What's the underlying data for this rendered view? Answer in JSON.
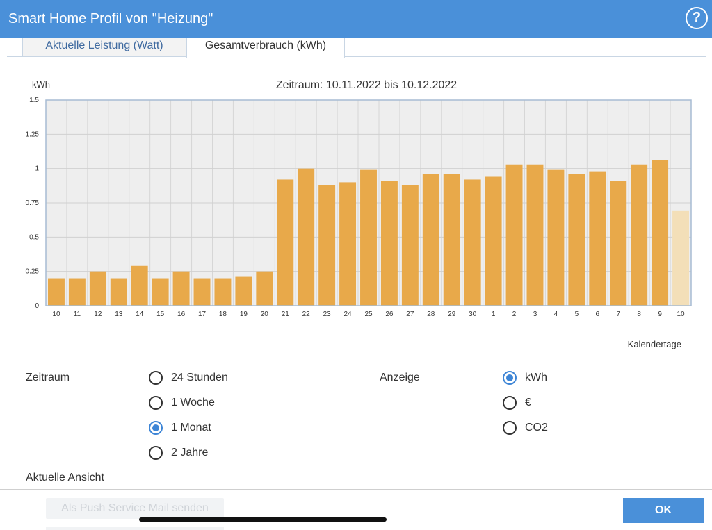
{
  "app": {
    "title": "Smart Home Profil von \"Heizung\"",
    "help_label": "?"
  },
  "tabs": [
    {
      "label": "Aktuelle Leistung (Watt)",
      "active": false
    },
    {
      "label": "Gesamtverbrauch (kWh)",
      "active": true
    }
  ],
  "chart_data": {
    "type": "bar",
    "title": "Zeitraum: 10.11.2022 bis 10.12.2022",
    "ylabel": "kWh",
    "xlabel": "Kalendertage",
    "ylim": [
      0,
      1.5
    ],
    "yticks": [
      "0",
      "0.25",
      "0.5",
      "0.75",
      "1",
      "1.25",
      "1.5"
    ],
    "grid": true,
    "categories": [
      "10",
      "11",
      "12",
      "13",
      "14",
      "15",
      "16",
      "17",
      "18",
      "19",
      "20",
      "21",
      "22",
      "23",
      "24",
      "25",
      "26",
      "27",
      "28",
      "29",
      "30",
      "1",
      "2",
      "3",
      "4",
      "5",
      "6",
      "7",
      "8",
      "9",
      "10"
    ],
    "values": [
      0.2,
      0.2,
      0.25,
      0.2,
      0.29,
      0.2,
      0.25,
      0.2,
      0.2,
      0.21,
      0.25,
      0.92,
      1.0,
      0.88,
      0.9,
      0.99,
      0.91,
      0.88,
      0.96,
      0.96,
      0.92,
      0.94,
      1.03,
      1.03,
      0.99,
      0.96,
      0.98,
      0.91,
      1.03,
      1.06,
      0.69
    ],
    "bar_color": "#e8a94a",
    "partial_bar_color": "#f3dfb8"
  },
  "settings": {
    "zeitraum_label": "Zeitraum",
    "zeitraum_options": [
      {
        "label": "24 Stunden",
        "checked": false
      },
      {
        "label": "1 Woche",
        "checked": false
      },
      {
        "label": "1 Monat",
        "checked": true
      },
      {
        "label": "2 Jahre",
        "checked": false
      }
    ],
    "anzeige_label": "Anzeige",
    "anzeige_options": [
      {
        "label": "kWh",
        "checked": true
      },
      {
        "label": "€",
        "checked": false
      },
      {
        "label": "CO2",
        "checked": false
      }
    ],
    "aktuelle_ansicht_label": "Aktuelle Ansicht"
  },
  "footer": {
    "push_button_label": "Als Push Service Mail senden",
    "ok_label": "OK"
  },
  "colors": {
    "accent": "#4a90d9",
    "radio_checked": "#3d85d6",
    "plot_bg": "#eeeeee"
  }
}
